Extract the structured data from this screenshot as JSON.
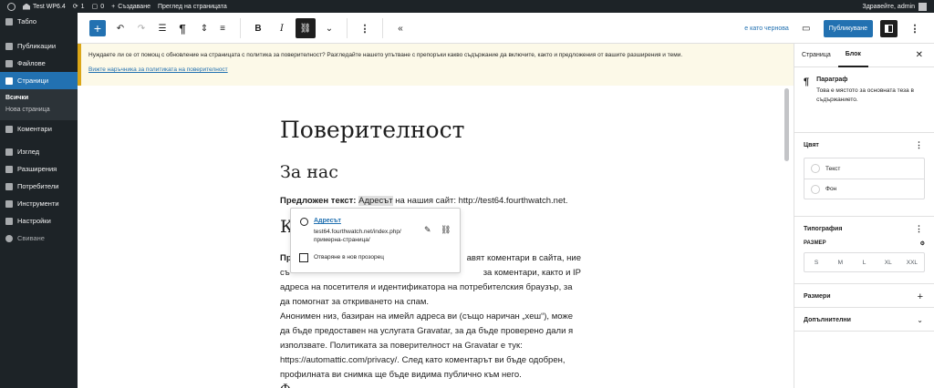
{
  "adminbar": {
    "site_name": "Test WP6.4",
    "update_count": "1",
    "comment_count": "0",
    "new_label": "Създаване",
    "view_page": "Преглед на страницата",
    "greeting": "Здравейте, admin"
  },
  "sidebar": {
    "items": [
      {
        "label": "Табло",
        "icon": "dashboard-icon"
      },
      {
        "label": "Публикации",
        "icon": "pin-icon"
      },
      {
        "label": "Файлове",
        "icon": "media-icon"
      },
      {
        "label": "Страници",
        "icon": "pages-icon"
      },
      {
        "label": "Коментари",
        "icon": "comments-icon"
      },
      {
        "label": "Изглед",
        "icon": "appearance-icon"
      },
      {
        "label": "Разширения",
        "icon": "plugins-icon"
      },
      {
        "label": "Потребители",
        "icon": "users-icon"
      },
      {
        "label": "Инструменти",
        "icon": "tools-icon"
      },
      {
        "label": "Настройки",
        "icon": "settings-icon"
      }
    ],
    "submenu": [
      "Всички",
      "Нова страница"
    ],
    "collapse_label": "Свиване"
  },
  "toolbar": {
    "paragraph_glyph": "¶",
    "bold": "B",
    "italic": "I",
    "draft_label": "е като чернова",
    "publish_label": "Публикуване"
  },
  "notice": {
    "text": "Нуждаете ли се от помощ с обновление на страницата с политика за поверителност? Разгледайте нашето упътване с препоръки какво съдържание да включите, както и предложения от вашите разширения и теми.",
    "link": "Вижте наръчника за политиката на поверителност"
  },
  "content": {
    "title": "Поверителност",
    "heading_about": "За нас",
    "suggested_label": "Предложен текст:",
    "p1_selected": "Адресът",
    "p1_rest": " на нашия сайт: http://test64.fourthwatch.net.",
    "heading_comments_partial": "К",
    "p2_l1_bold": "Пр",
    "p2_l1_rest": "авят коментари в сайта, ние",
    "p2_l2_start": "съ",
    "p2_l2_rest": "за коментари, както и IP",
    "p2_l3": "адреса на посетителя и идентификатора на потребителския браузър, за",
    "p2_l4": "да помогнат за откриването на спам.",
    "p3": "Анонимен низ, базиран на имейл адреса ви (също наричан „хеш“), може да бъде предоставен на услугата Gravatar, за да бъде проверено дали я използвате. Политиката за поверителност на Gravatar е тук: https://automattic.com/privacy/. След като коментарът ви бъде одобрен, профилната ви снимка ще бъде видима публично към него.",
    "p4_partial": "Ф"
  },
  "link_popover": {
    "title": "Адресът",
    "url": "test64.fourthwatch.net/index.php/примерна-страница/",
    "new_tab_label": "Отваряне в нов прозорец"
  },
  "panel": {
    "tabs": [
      "Страница",
      "Блок"
    ],
    "block_name": "Параграф",
    "block_desc": "Това е мястото за основната теза в съдържанието.",
    "color_title": "Цвят",
    "color_text": "Текст",
    "color_bg": "Фон",
    "typography_title": "Типография",
    "size_label": "Размер",
    "sizes": [
      "S",
      "M",
      "L",
      "XL",
      "XXL"
    ],
    "dimensions_title": "Размери",
    "advanced_title": "Допълнителни"
  }
}
